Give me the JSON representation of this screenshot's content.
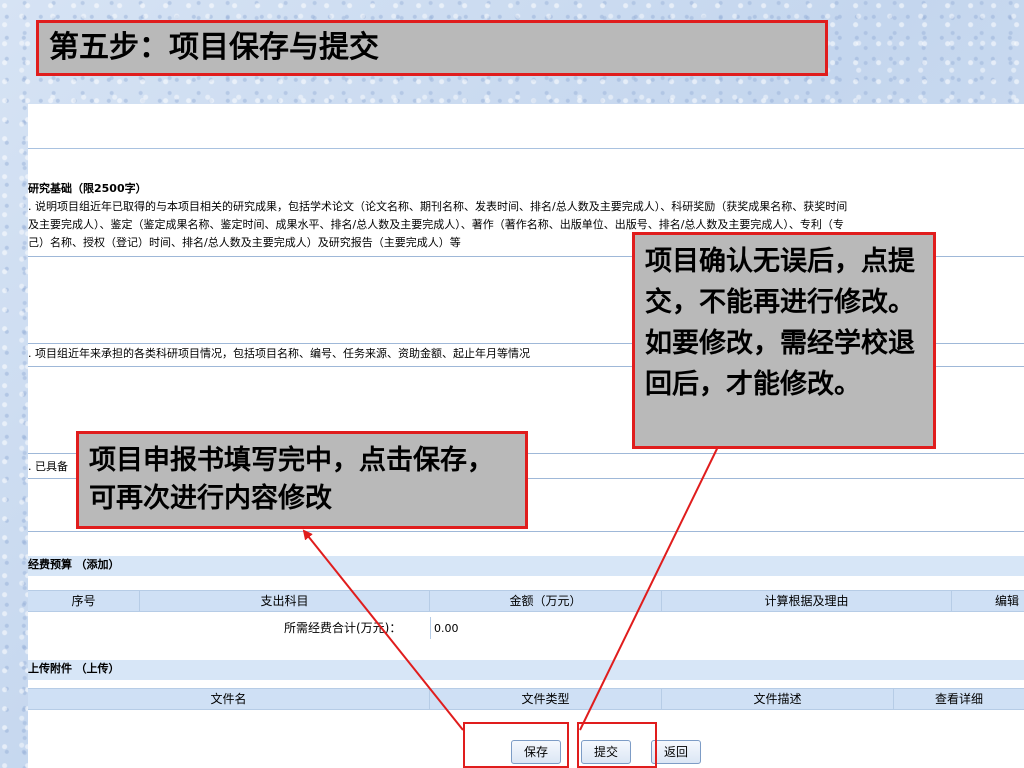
{
  "slide": {
    "title": "第五步：项目保存与提交"
  },
  "form": {
    "research_basis_header": "研究基础（限2500字）",
    "research_basis_desc": [
      ". 说明项目组近年已取得的与本项目相关的研究成果，包括学术论文（论文名称、期刊名称、发表时间、排名/总人数及主要完成人）、科研奖励（获奖成果名称、获奖时间",
      "及主要完成人）、鉴定（鉴定成果名称、鉴定时间、成果水平、排名/总人数及主要完成人）、著作（著作名称、出版单位、出版号、排名/总人数及主要完成人）、专利（专",
      "己）名称、授权（登记）时间、排名/总人数及主要完成人）及研究报告（主要完成人）等"
    ],
    "projects_desc": ". 项目组近年来承担的各类科研项目情况，包括项目名称、编号、任务来源、资助金额、起止年月等情况",
    "conditions_desc": ". 已具备",
    "budget": {
      "header": "经费预算",
      "add_link": "（添加）",
      "columns": [
        "序号",
        "支出科目",
        "金额（万元）",
        "计算根据及理由",
        "编辑"
      ],
      "total_label": "所需经费合计(万元)：",
      "total_value": "0.00"
    },
    "attachments": {
      "header": "上传附件",
      "upload_link": "（上传）",
      "columns": [
        "文件名",
        "文件类型",
        "文件描述",
        "查看详细"
      ]
    },
    "buttons": {
      "save": "保存",
      "submit": "提交",
      "back": "返回"
    }
  },
  "callouts": {
    "save_note": "项目申报书填写完中，点击保存，可再次进行内容修改",
    "submit_note": "项目确认无误后，点提交，不能再进行修改。如要修改，需经学校退回后，才能修改。"
  },
  "colors": {
    "highlight": "#e01d1d",
    "callout_bg": "#b9b9b9",
    "table_header": "#cfe0f5",
    "band": "#d7e6f7"
  }
}
